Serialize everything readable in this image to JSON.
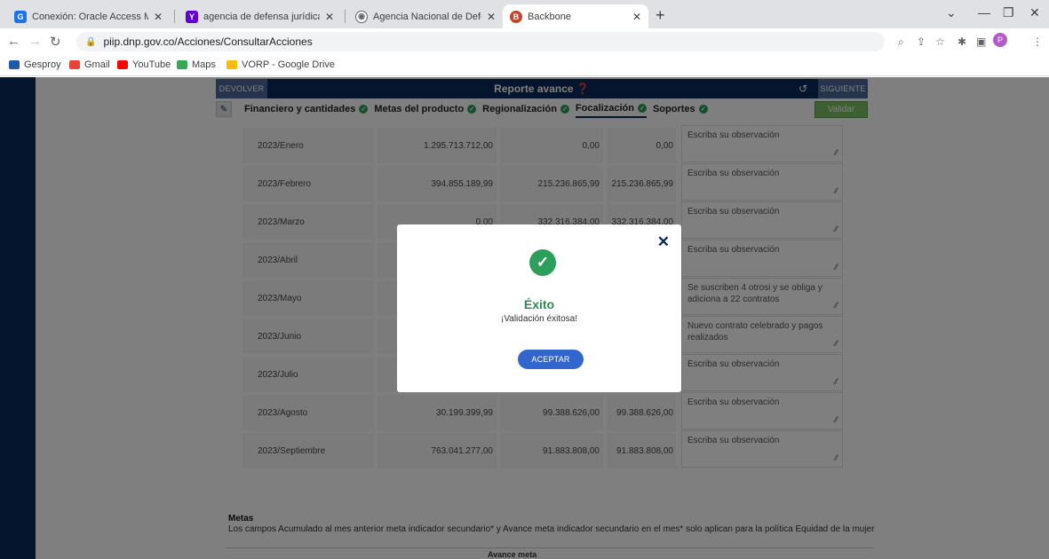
{
  "browser": {
    "tabs": [
      {
        "title": "Conexión: Oracle Access Manag",
        "icon": "oracle-icon",
        "color": "#1a73e8"
      },
      {
        "title": "agencia de defensa jurídica del",
        "icon": "yahoo-icon",
        "color": "#6001d2"
      },
      {
        "title": "Agencia Nacional de Defensa Ju",
        "icon": "globe-icon",
        "color": "#5f6368"
      },
      {
        "title": "Backbone",
        "icon": "backbone-icon",
        "color": "#c5432b"
      }
    ],
    "new_tab": "+",
    "url": "piip.dnp.gov.co/Acciones/ConsultarAcciones",
    "profile": "P",
    "bookmarks": [
      "Gesproy",
      "Gmail",
      "YouTube",
      "Maps",
      "VORP - Google Drive"
    ]
  },
  "panel": {
    "devolver": "DEVOLVER",
    "title": "Reporte avance ❓",
    "siguiente": "SIGUIENTE",
    "validar": "Validar",
    "tabs": [
      "Financiero y cantidades",
      "Metas del producto",
      "Regionalización",
      "Focalización",
      "Soportes"
    ]
  },
  "rows": [
    {
      "month": "2023/Enero",
      "v1": "1.295.713.712,00",
      "v2": "0,00",
      "v3": "0,00",
      "obs": "Escriba su observación"
    },
    {
      "month": "2023/Febrero",
      "v1": "394.855.189,99",
      "v2": "215.236.865,99",
      "v3": "215.236.865,99",
      "obs": "Escriba su observación"
    },
    {
      "month": "2023/Marzo",
      "v1": "0,00",
      "v2": "332.316.384,00",
      "v3": "332.316.384,00",
      "obs": "Escriba su observación"
    },
    {
      "month": "2023/Abril",
      "v1": "",
      "v2": "",
      "v3": "",
      "obs": "Escriba su observación"
    },
    {
      "month": "2023/Mayo",
      "v1": "",
      "v2": "",
      "v3": "",
      "obs": "Se suscriben 4 otrosi y se obliga y adiciona a 22 contratos"
    },
    {
      "month": "2023/Junio",
      "v1": "",
      "v2": "",
      "v3": "",
      "obs": "Nuevo contrato celebrado y pagos realizados"
    },
    {
      "month": "2023/Julio",
      "v1": "",
      "v2": "",
      "v3": "",
      "obs": "Escriba su observación"
    },
    {
      "month": "2023/Agosto",
      "v1": "30.199.399,99",
      "v2": "99.388.626,00",
      "v3": "99.388.626,00",
      "obs": "Escriba su observación"
    },
    {
      "month": "2023/Septiembre",
      "v1": "763.041.277,00",
      "v2": "91.883.808,00",
      "v3": "91.883.808,00",
      "obs": "Escriba su observación"
    }
  ],
  "metas": {
    "title": "Metas",
    "text": "Los campos Acumulado al mes anterior meta indicador secundario* y Avance meta indicador secundario en el mes* solo aplican para la política Equidad de la mujer",
    "col_header": "Avance meta"
  },
  "modal": {
    "title": "Éxito",
    "message": "¡Validación éxitosa!",
    "accept": "ACEPTAR"
  }
}
